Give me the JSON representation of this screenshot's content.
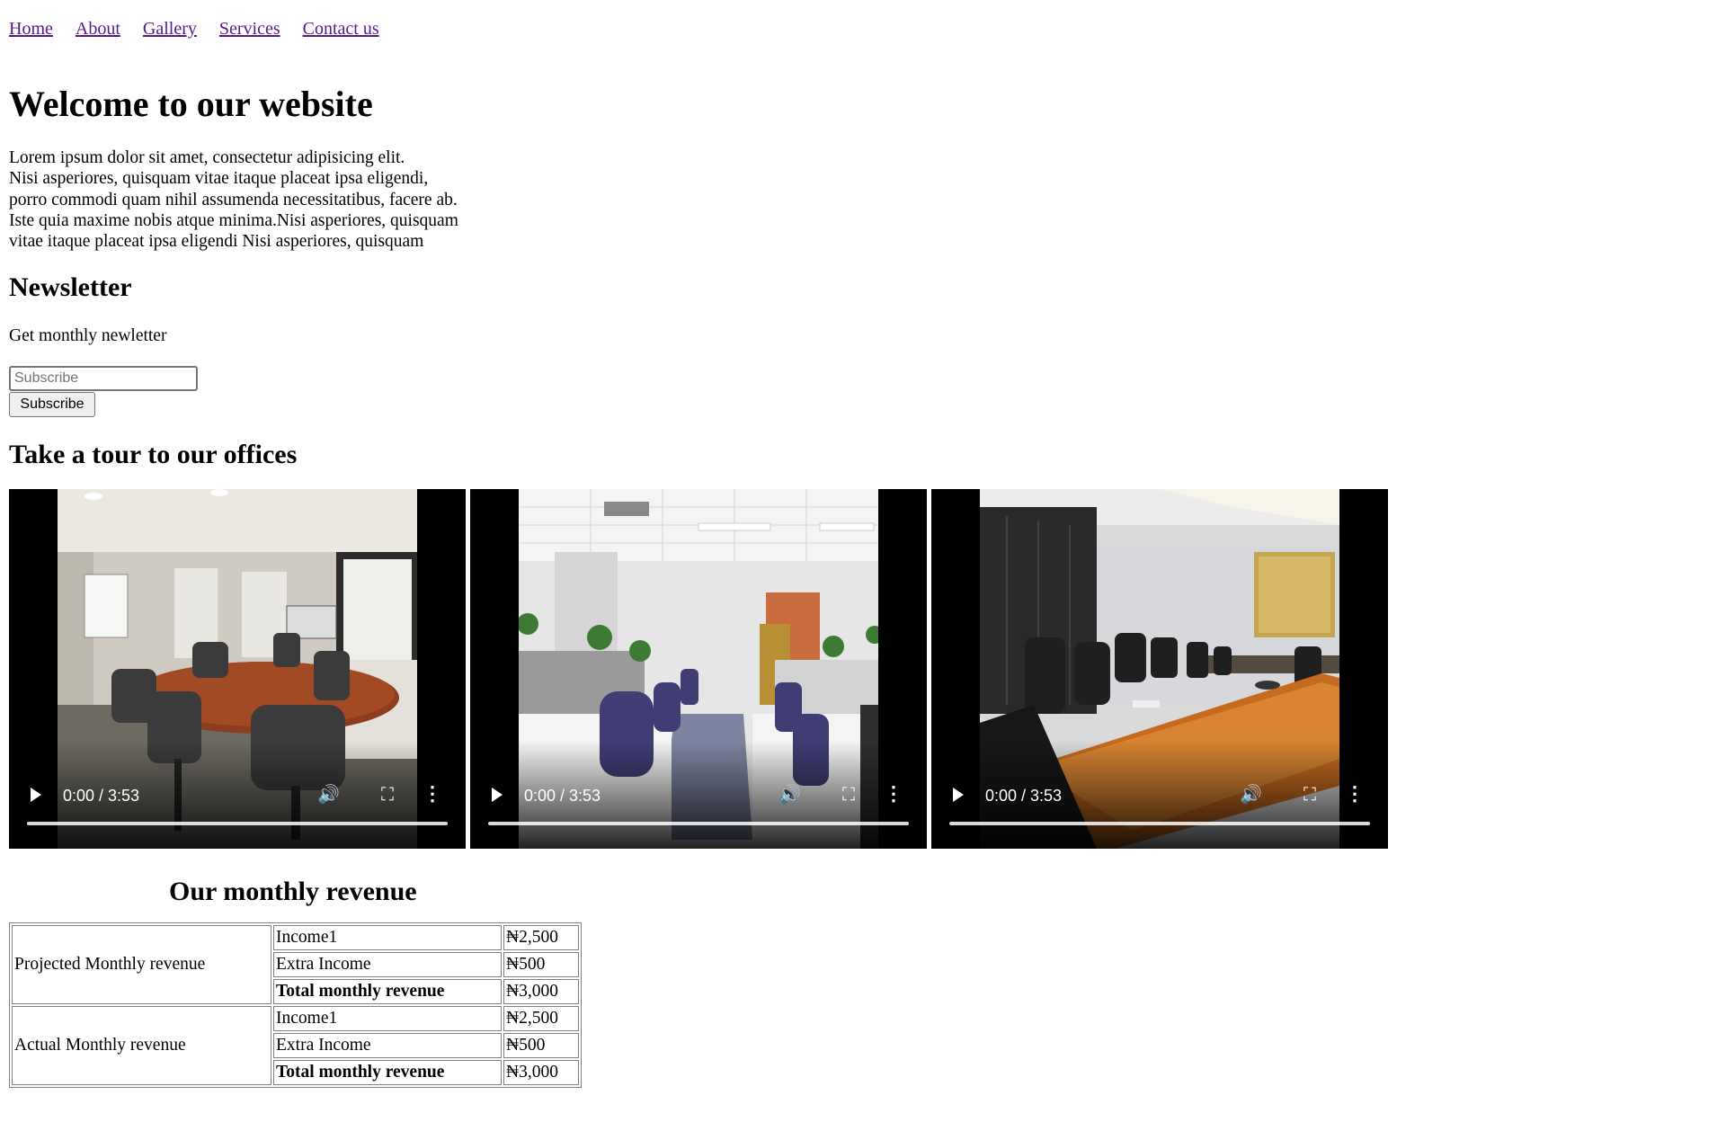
{
  "nav": {
    "items": [
      "Home",
      "About",
      "Gallery",
      "Services",
      "Contact us"
    ]
  },
  "hero": {
    "title": "Welcome to our website",
    "lines": [
      "Lorem ipsum dolor sit amet, consectetur adipisicing elit.",
      "Nisi asperiores, quisquam vitae itaque placeat ipsa eligendi,",
      "porro commodi quam nihil assumenda necessitatibus, facere ab.",
      "Iste quia maxime nobis atque minima.Nisi asperiores, quisquam",
      "vitae itaque placeat ipsa eligendi Nisi asperiores, quisquam"
    ]
  },
  "newsletter": {
    "title": "Newsletter",
    "subtitle": "Get monthly newletter",
    "input_placeholder": "Subscribe",
    "button_label": "Subscribe"
  },
  "tour": {
    "title": "Take a tour to our offices",
    "videos": [
      {
        "time": "0:00 / 3:53"
      },
      {
        "time": "0:00 / 3:53"
      },
      {
        "time": "0:00 / 3:53"
      }
    ]
  },
  "revenue": {
    "title": "Our monthly revenue",
    "groups": [
      {
        "label": "Projected Monthly revenue",
        "rows": [
          {
            "name": "Income1",
            "value": "₦2,500"
          },
          {
            "name": "Extra Income",
            "value": "₦500"
          },
          {
            "name": "Total monthly revenue",
            "value": "₦3,000"
          }
        ]
      },
      {
        "label": "Actual Monthly revenue",
        "rows": [
          {
            "name": "Income1",
            "value": "₦2,500"
          },
          {
            "name": "Extra Income",
            "value": "₦500"
          },
          {
            "name": "Total monthly revenue",
            "value": "₦3,000"
          }
        ]
      }
    ]
  },
  "colors": {
    "link": "#551a8b",
    "border": "#808080"
  }
}
